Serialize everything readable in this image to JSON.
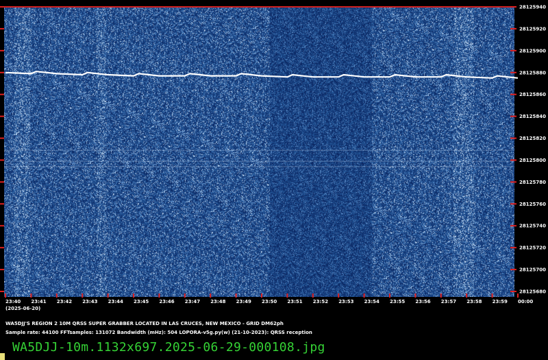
{
  "chart_data": {
    "type": "waterfall",
    "x_ticks": [
      "23:40",
      "23:41",
      "23:42",
      "23:43",
      "23:44",
      "23:45",
      "23:46",
      "23:47",
      "23:48",
      "23:49",
      "23:50",
      "23:51",
      "23:52",
      "23:53",
      "23:54",
      "23:55",
      "23:56",
      "23:57",
      "23:58",
      "23:59",
      "00:00"
    ],
    "y_ticks": [
      28125940,
      28125920,
      28125900,
      28125880,
      28125860,
      28125840,
      28125820,
      28125800,
      28125780,
      28125760,
      28125740,
      28125720,
      28125700,
      28125680
    ],
    "ylim": [
      28125675,
      28125940
    ],
    "signal": {
      "x": [
        0,
        1,
        1.2,
        2,
        3,
        3.2,
        4,
        5,
        5.2,
        6,
        7,
        7.2,
        8,
        9,
        9.2,
        10,
        11,
        11.2,
        12,
        13,
        13.2,
        14,
        15,
        15.2,
        16,
        17,
        17.2,
        18,
        19,
        19.2,
        20
      ],
      "y": [
        28125880,
        28125879,
        28125881,
        28125879,
        28125878,
        28125880,
        28125878,
        28125877,
        28125879,
        28125877,
        28125877,
        28125879,
        28125877,
        28125877,
        28125879,
        28125877,
        28125876,
        28125878,
        28125876,
        28125876,
        28125878,
        28125876,
        28125876,
        28125878,
        28125876,
        28125876,
        28125878,
        28125876,
        28125875,
        28125877,
        28125875
      ]
    },
    "faint_lines": [
      28125809,
      28125799,
      28125794
    ],
    "colors": {
      "background": "#1e4b86",
      "signal": "#ffffff",
      "tick": "#e02020",
      "border": "#d02020"
    }
  },
  "date_label": "(2025-06-20)",
  "station_text": "WA5DJJ'S REGION 2 10M QRSS SUPER GRABBER LOCATED IN LAS CRUCES, NEW MEXICO - GRID DM62ph",
  "sample_text": "Sample rate: 44100    FFTsamples: 131072    Bandwidth (mHz): 504        LOPORA-v5g.py(w) (21-10-2023): QRSS reception",
  "filename": "WA5DJJ-10m.1132x697.2025-06-29-000108.jpg"
}
